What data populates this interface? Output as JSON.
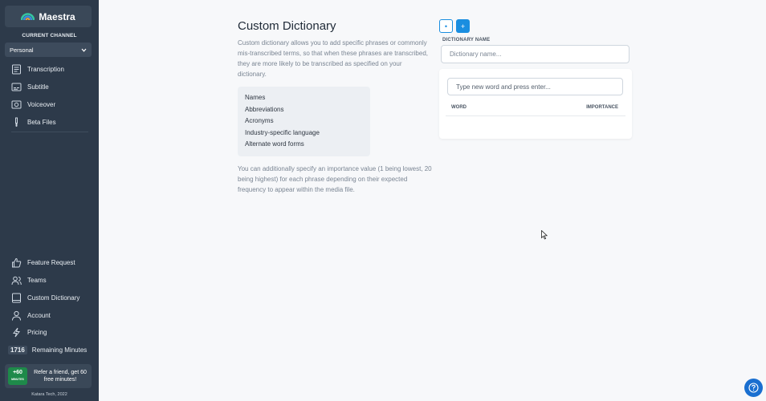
{
  "app": {
    "name": "Maestra"
  },
  "sidebar": {
    "current_channel_label": "CURRENT CHANNEL",
    "channel_value": "Personal",
    "top_items": [
      {
        "label": "Transcription",
        "icon": "transcription-icon"
      },
      {
        "label": "Subtitle",
        "icon": "subtitle-icon"
      },
      {
        "label": "Voiceover",
        "icon": "voiceover-icon"
      },
      {
        "label": "Beta Files",
        "icon": "beta-icon"
      }
    ],
    "bottom_items": [
      {
        "label": "Feature Request",
        "icon": "thumbs-up-icon"
      },
      {
        "label": "Teams",
        "icon": "teams-icon"
      },
      {
        "label": "Custom Dictionary",
        "icon": "dictionary-icon"
      },
      {
        "label": "Account",
        "icon": "user-icon"
      },
      {
        "label": "Pricing",
        "icon": "lightning-icon"
      }
    ],
    "remaining_minutes": {
      "count": "1716",
      "label": "Remaining Minutes"
    },
    "refer": {
      "badge_top": "+60",
      "badge_bottom": "MINUTES",
      "text": "Refer a friend, get 60 free minutes!"
    },
    "footer": "Katara Tech, 2022"
  },
  "main": {
    "title": "Custom Dictionary",
    "description": "Custom dictionary allows you to add specific phrases or commonly mis-transcribed terms, so that when these phrases are transcribed, they are more likely to be transcribed as specified on your dictionary.",
    "examples": [
      "Names",
      "Abbreviations",
      "Acronyms",
      "Industry-specific language",
      "Alternate word forms"
    ],
    "importance_note": "You can additionally specify an importance value (1 being lowest, 20 being highest) for each phrase depending on their expected frequency to appear within the media file."
  },
  "editor": {
    "button_outline_symbol": "•",
    "button_solid_symbol": "+",
    "dictionary_name_label": "DICTIONARY NAME",
    "dictionary_name_placeholder": "Dictionary name...",
    "word_placeholder": "Type new word and press enter...",
    "col_word": "WORD",
    "col_importance": "IMPORTANCE"
  },
  "colors": {
    "sidebar_bg": "#2d3a4a",
    "accent": "#1a8ee0",
    "help": "#1a6fd0"
  }
}
